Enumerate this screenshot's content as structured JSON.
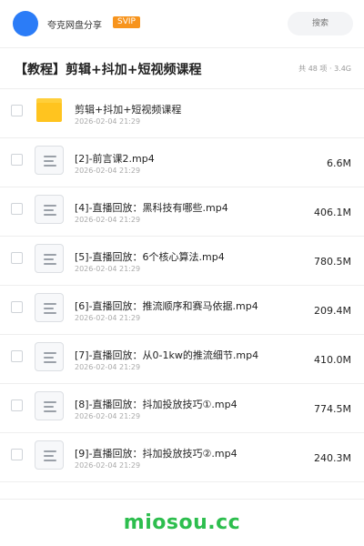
{
  "header": {
    "app_name": "夸克网盘分享",
    "badge": "SVIP",
    "search_placeholder": "搜索",
    "accent_color": "#2b7cf7",
    "badge_color": "#f7941d"
  },
  "folder": {
    "title": "【教程】剪辑+抖加+短视频课程",
    "meta": "共 48 项 · 3.4G"
  },
  "items": [
    {
      "type": "folder",
      "icon": "folder-icon",
      "name": "剪辑+抖加+短视频课程",
      "date": "2026-02-04 21:29",
      "size": ""
    },
    {
      "type": "file",
      "icon": "file-icon",
      "name": "[2]-前言课2.mp4",
      "date": "2026-02-04 21:29",
      "size": "6.6M"
    },
    {
      "type": "file",
      "icon": "file-icon",
      "name": "[4]-直播回放：黑科技有哪些.mp4",
      "date": "2026-02-04 21:29",
      "size": "406.1M"
    },
    {
      "type": "file",
      "icon": "file-icon",
      "name": "[5]-直播回放：6个核心算法.mp4",
      "date": "2026-02-04 21:29",
      "size": "780.5M"
    },
    {
      "type": "file",
      "icon": "file-icon",
      "name": "[6]-直播回放：推流顺序和赛马依据.mp4",
      "date": "2026-02-04 21:29",
      "size": "209.4M"
    },
    {
      "type": "file",
      "icon": "file-icon",
      "name": "[7]-直播回放：从0-1kw的推流细节.mp4",
      "date": "2026-02-04 21:29",
      "size": "410.0M"
    },
    {
      "type": "file",
      "icon": "file-icon",
      "name": "[8]-直播回放：抖加投放技巧①.mp4",
      "date": "2026-02-04 21:29",
      "size": "774.5M"
    },
    {
      "type": "file",
      "icon": "file-icon",
      "name": "[9]-直播回放：抖加投放技巧②.mp4",
      "date": "2026-02-04 21:29",
      "size": "240.3M"
    }
  ],
  "watermark": "miosou.cc"
}
